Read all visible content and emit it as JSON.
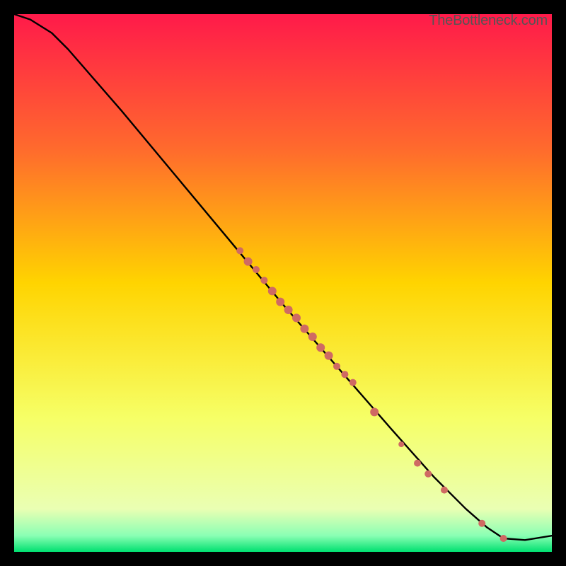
{
  "watermark": "TheBottleneck.com",
  "chart_data": {
    "type": "line",
    "title": "",
    "xlabel": "",
    "ylabel": "",
    "xlim": [
      0,
      100
    ],
    "ylim": [
      0,
      100
    ],
    "grid": false,
    "legend": false,
    "gradient_stops": [
      {
        "offset": 0,
        "color": "#ff1a4a"
      },
      {
        "offset": 25,
        "color": "#ff6a2d"
      },
      {
        "offset": 50,
        "color": "#ffd400"
      },
      {
        "offset": 75,
        "color": "#f6ff66"
      },
      {
        "offset": 92,
        "color": "#eaffb3"
      },
      {
        "offset": 97,
        "color": "#8affb4"
      },
      {
        "offset": 100,
        "color": "#00e070"
      }
    ],
    "series": [
      {
        "name": "curve",
        "type": "line",
        "color": "#000000",
        "x": [
          0,
          3,
          7,
          10,
          20,
          30,
          40,
          50,
          60,
          70,
          78,
          84,
          88,
          91,
          95,
          100
        ],
        "y": [
          100,
          99,
          96.5,
          93.5,
          82,
          70,
          58,
          46,
          34.5,
          23,
          14,
          8,
          4.5,
          2.5,
          2.2,
          3
        ]
      },
      {
        "name": "points",
        "type": "scatter",
        "color": "#cf6a63",
        "points": [
          {
            "x": 42,
            "y": 56,
            "r": 5
          },
          {
            "x": 43.5,
            "y": 54,
            "r": 6
          },
          {
            "x": 45,
            "y": 52.5,
            "r": 5
          },
          {
            "x": 46.5,
            "y": 50.5,
            "r": 5
          },
          {
            "x": 48,
            "y": 48.5,
            "r": 6
          },
          {
            "x": 49.5,
            "y": 46.5,
            "r": 6
          },
          {
            "x": 51,
            "y": 45,
            "r": 6
          },
          {
            "x": 52.5,
            "y": 43.5,
            "r": 6
          },
          {
            "x": 54,
            "y": 41.5,
            "r": 6
          },
          {
            "x": 55.5,
            "y": 40,
            "r": 6
          },
          {
            "x": 57,
            "y": 38,
            "r": 6
          },
          {
            "x": 58.5,
            "y": 36.5,
            "r": 6
          },
          {
            "x": 60,
            "y": 34.5,
            "r": 5
          },
          {
            "x": 61.5,
            "y": 33,
            "r": 5
          },
          {
            "x": 63,
            "y": 31.5,
            "r": 5
          },
          {
            "x": 67,
            "y": 26,
            "r": 6
          },
          {
            "x": 72,
            "y": 20,
            "r": 4
          },
          {
            "x": 75,
            "y": 16.5,
            "r": 5
          },
          {
            "x": 77,
            "y": 14.5,
            "r": 5
          },
          {
            "x": 80,
            "y": 11.5,
            "r": 5
          },
          {
            "x": 87,
            "y": 5.3,
            "r": 5
          },
          {
            "x": 91,
            "y": 2.5,
            "r": 5
          }
        ]
      }
    ]
  }
}
